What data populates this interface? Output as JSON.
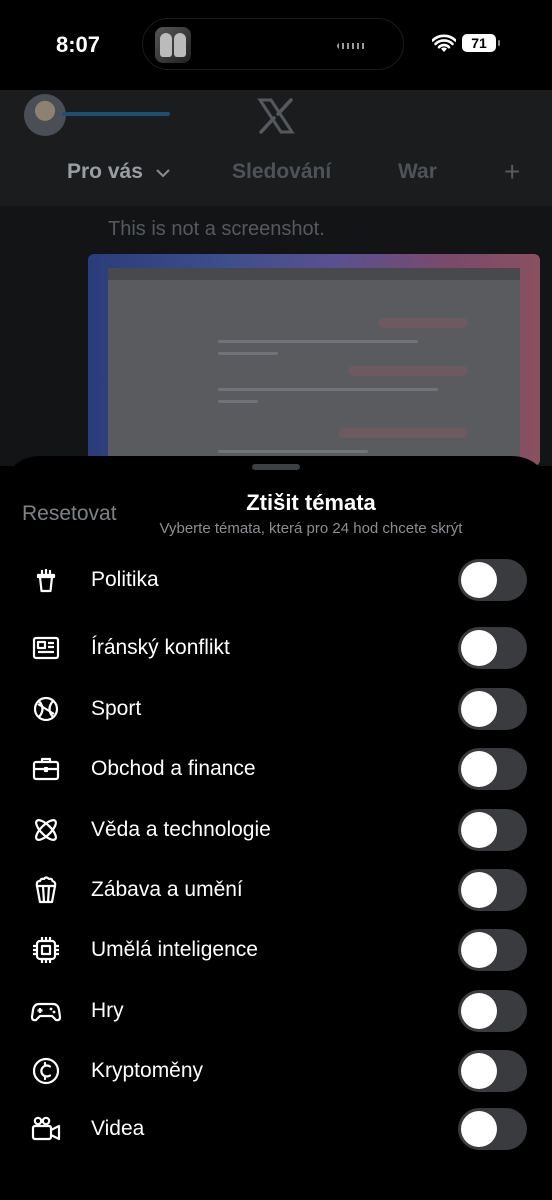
{
  "status_bar": {
    "time": "8:07",
    "battery": "71"
  },
  "x_header": {
    "tabs": [
      {
        "label": "Pro vás",
        "icon": "chevron-down-icon"
      },
      {
        "label": "Sledování"
      },
      {
        "label": "War"
      }
    ],
    "add_tab_icon": "plus-icon"
  },
  "feed": {
    "post_text": "This is not a screenshot."
  },
  "sheet": {
    "reset_label": "Resetovat",
    "title": "Ztišit témata",
    "subtitle": "Vyberte témata, která pro 24 hod chcete skrýt",
    "topics": [
      {
        "label": "Politika",
        "icon": "podium-icon",
        "enabled": false
      },
      {
        "label": "Íránský konflikt",
        "icon": "newspaper-icon",
        "enabled": false
      },
      {
        "label": "Sport",
        "icon": "ball-icon",
        "enabled": false
      },
      {
        "label": "Obchod a finance",
        "icon": "briefcase-icon",
        "enabled": false
      },
      {
        "label": "Věda a technologie",
        "icon": "atom-icon",
        "enabled": false
      },
      {
        "label": "Zábava a umění",
        "icon": "popcorn-icon",
        "enabled": false
      },
      {
        "label": "Umělá inteligence",
        "icon": "chip-icon",
        "enabled": false
      },
      {
        "label": "Hry",
        "icon": "gamepad-icon",
        "enabled": false
      },
      {
        "label": "Kryptoměny",
        "icon": "coin-icon",
        "enabled": false
      },
      {
        "label": "Videa",
        "icon": "video-camera-icon",
        "enabled": false
      }
    ]
  },
  "colors": {
    "sheet_background": "#000000",
    "toggle_off": "#3a3b3f",
    "accent_underline": "#1d4f74"
  }
}
